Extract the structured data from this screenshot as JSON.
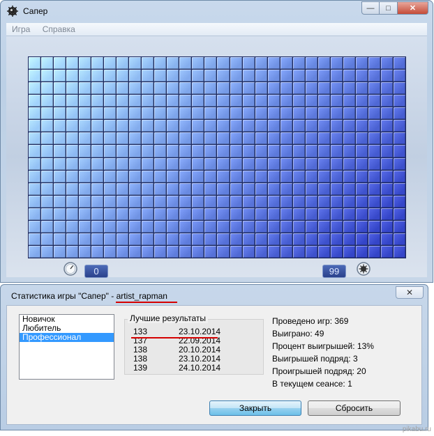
{
  "game_window": {
    "title": "Сапер",
    "menu": [
      "Игра",
      "Справка"
    ],
    "board": {
      "columns": 30,
      "rows": 16
    },
    "timer_value": "0",
    "mines_remaining": "99",
    "caption_buttons": {
      "minimize": "—",
      "maximize": "□",
      "close": "✕"
    }
  },
  "stats_dialog": {
    "title_prefix": "Статистика игры \"Сапер\" - ",
    "username": "artist_rapman",
    "close_glyph": "✕",
    "levels": [
      {
        "label": "Новичок",
        "selected": false
      },
      {
        "label": "Любитель",
        "selected": false
      },
      {
        "label": "Профессионал",
        "selected": true
      }
    ],
    "best_results_label": "Лучшие результаты",
    "best_results": [
      {
        "time": "133",
        "date": "23.10.2014"
      },
      {
        "time": "137",
        "date": "22.09.2014"
      },
      {
        "time": "138",
        "date": "20.10.2014"
      },
      {
        "time": "138",
        "date": "23.10.2014"
      },
      {
        "time": "139",
        "date": "24.10.2014"
      }
    ],
    "stats": [
      "Проведено игр: 369",
      "Выиграно: 49",
      "Процент выигрышей: 13%",
      "Выигрышей подряд: 3",
      "Проигрышей подряд: 20",
      "В текущем сеансе: 1"
    ],
    "buttons": {
      "close": "Закрыть",
      "reset": "Сбросить"
    }
  },
  "watermark": "pikabu.ru",
  "colors": {
    "tile_light": "#a9ddff",
    "tile_dark": "#3445c8",
    "selection": "#3399ff",
    "red_mark": "#d50000"
  }
}
